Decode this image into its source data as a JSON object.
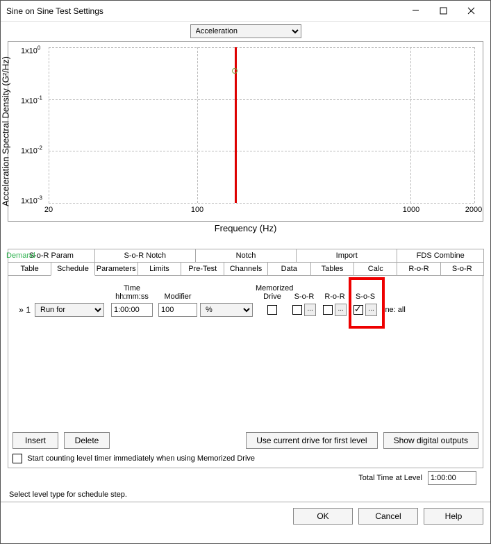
{
  "window": {
    "title": "Sine on Sine Test Settings"
  },
  "chart_data": {
    "type": "line",
    "title": "",
    "xlabel": "Frequency (Hz)",
    "ylabel": "Acceleration Spectral Density (G²/Hz)",
    "xscale": "log",
    "yscale": "log",
    "xlim": [
      20,
      2000
    ],
    "ylim": [
      0.001,
      1
    ],
    "xticks": [
      20,
      100,
      1000,
      2000
    ],
    "ytick_exp": [
      0,
      -1,
      -2,
      -3
    ],
    "series": [
      {
        "name": "Demand",
        "x": [
          150
        ],
        "y": [
          1.0
        ],
        "style": "vertical-line",
        "color": "#cc0000"
      }
    ],
    "markers": [
      {
        "x": 150,
        "y": 1.0
      }
    ],
    "dropdown": {
      "selected": "Acceleration"
    }
  },
  "demand_legend": "Demand",
  "tabs_row1": [
    {
      "label": "S-o-R Param"
    },
    {
      "label": "S-o-R Notch"
    },
    {
      "label": "Notch"
    },
    {
      "label": "Import"
    },
    {
      "label": "FDS Combine"
    }
  ],
  "tabs_row2": [
    {
      "label": "Table"
    },
    {
      "label": "Schedule",
      "active": true
    },
    {
      "label": "Parameters"
    },
    {
      "label": "Limits"
    },
    {
      "label": "Pre-Test"
    },
    {
      "label": "Channels"
    },
    {
      "label": "Data"
    },
    {
      "label": "Tables"
    },
    {
      "label": "Calc"
    },
    {
      "label": "R-o-R"
    },
    {
      "label": "S-o-R"
    }
  ],
  "schedule": {
    "headers": {
      "time_top": "Time",
      "time_bot": "hh:mm:ss",
      "modifier": "Modifier",
      "mem_top": "Memorized",
      "mem_bot": "Drive",
      "sor": "S-o-R",
      "ror": "R-o-R",
      "sos": "S-o-S"
    },
    "rows": [
      {
        "idx": "1",
        "prefix": "»",
        "action": "Run for",
        "time": "1:00:00",
        "modifier_val": "100",
        "modifier_unit": "%",
        "mem": false,
        "sor": false,
        "ror": false,
        "sos": true,
        "tail": "ine: all"
      }
    ]
  },
  "buttons": {
    "insert": "Insert",
    "delete": "Delete",
    "use_current": "Use current drive for first level",
    "show_digital": "Show digital outputs",
    "ok": "OK",
    "cancel": "Cancel",
    "help": "Help"
  },
  "start_counting_checkbox": {
    "checked": false,
    "label": "Start counting level timer immediately when using Memorized Drive"
  },
  "total_time": {
    "label": "Total Time at Level",
    "value": "1:00:00"
  },
  "status_text": "Select level type for schedule step.",
  "ellipsis": "..."
}
